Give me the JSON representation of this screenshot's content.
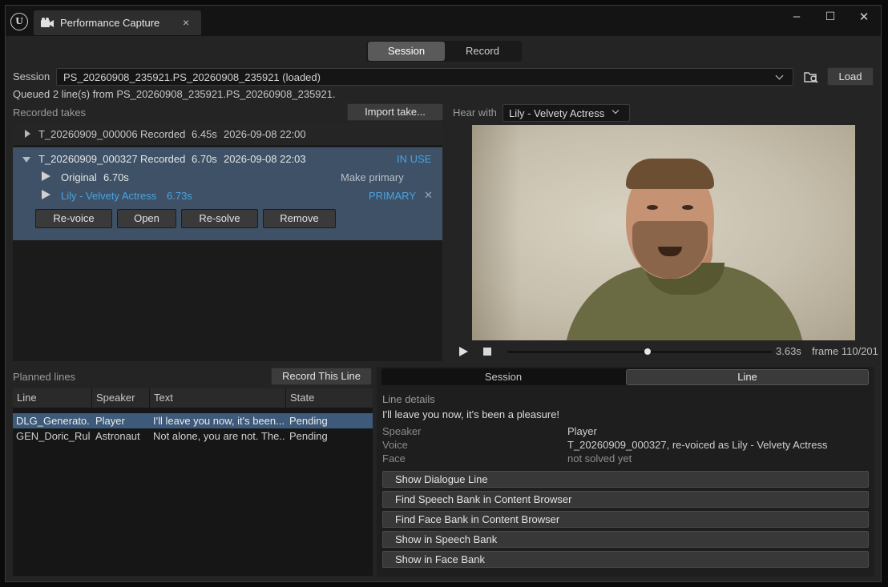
{
  "titlebar": {
    "tab_title": "Performance Capture",
    "close_glyph": "×",
    "minimize_glyph": "–",
    "maximize_glyph": "☐",
    "window_close_glyph": "✕"
  },
  "modes": {
    "session": "Session",
    "record": "Record",
    "active": "Session"
  },
  "session": {
    "label": "Session",
    "value": "PS_20260908_235921.PS_20260908_235921  (loaded)",
    "load_label": "Load",
    "status": "Queued 2 line(s) from PS_20260908_235921.PS_20260908_235921."
  },
  "takes": {
    "label": "Recorded takes",
    "import_label": "Import take...",
    "items": [
      {
        "name": "T_20260909_000006",
        "state": "Recorded",
        "duration": "6.45s",
        "date": "2026-09-08 22:00"
      },
      {
        "name": "T_20260909_000327",
        "state": "Recorded",
        "duration": "6.70s",
        "date": "2026-09-08 22:03",
        "badge": "IN USE",
        "variants": [
          {
            "name": "Original",
            "duration": "6.70s",
            "action": "Make primary"
          },
          {
            "name": "Lily - Velvety Actress",
            "duration": "6.73s",
            "badge": "PRIMARY",
            "remove_glyph": "✕"
          }
        ],
        "buttons": [
          "Re-voice",
          "Open",
          "Re-solve",
          "Remove"
        ]
      }
    ]
  },
  "hear_with": {
    "label": "Hear with",
    "value": "Lily - Velvety Actress"
  },
  "transport": {
    "time": "3.63s",
    "frame": "frame 110/201",
    "progress": 0.53
  },
  "planned": {
    "label": "Planned lines",
    "record_label": "Record This Line",
    "columns": [
      "Line",
      "Speaker",
      "Text",
      "State"
    ],
    "rows": [
      {
        "line": "DLG_Generato...",
        "speaker": "Player",
        "text": "I'll leave you now, it's been...",
        "state": "Pending",
        "selected": true
      },
      {
        "line": "GEN_Doric_Rule",
        "speaker": "Astronaut",
        "text": "Not alone, you are not. The...",
        "state": "Pending",
        "selected": false
      }
    ]
  },
  "details": {
    "tabs": [
      "Session",
      "Line"
    ],
    "active_tab": "Line",
    "heading": "Line details",
    "line_text": "I'll leave you now, it's been a pleasure!",
    "fields": [
      {
        "label": "Speaker",
        "value": "Player"
      },
      {
        "label": "Voice",
        "value": "T_20260909_000327, re-voiced as Lily - Velvety Actress"
      },
      {
        "label": "Face",
        "value": "not solved yet"
      }
    ],
    "actions": [
      "Show Dialogue Line",
      "Find Speech Bank in Content Browser",
      "Find Face Bank in Content Browser",
      "Show in Speech Bank",
      "Show in Face Bank"
    ]
  },
  "colors": {
    "accent_blue": "#4aa3e0",
    "selection": "#3e5166",
    "row_selected": "#3d5a7a"
  },
  "icons": {
    "logo": "unreal-logo-icon",
    "tab": "video-camera-icon",
    "browse": "folder-search-icon",
    "play": "play-icon",
    "stop": "stop-icon"
  }
}
